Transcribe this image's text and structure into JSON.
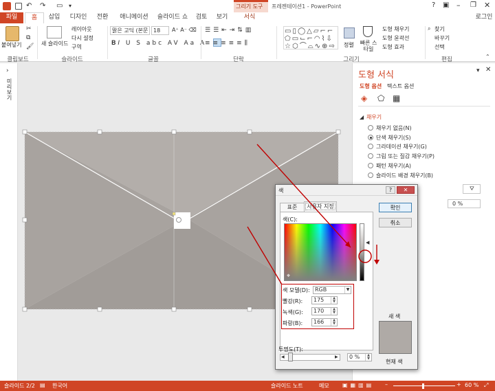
{
  "title": {
    "app_title": "프레젠테이션1 - PowerPoint",
    "context_group": "그리기 도구"
  },
  "tabs": [
    "파일",
    "홈",
    "삽입",
    "디자인",
    "전환",
    "애니메이션",
    "슬라이드 쇼",
    "검토",
    "보기",
    "서식"
  ],
  "account": "로그인",
  "ribbon": {
    "paste": "붙여넣기",
    "new_slide": "새 슬라이드",
    "layout": "레이아웃",
    "reset": "다시 설정",
    "section": "구역",
    "font_name": "맑은 고딕 (본문",
    "font_size": "18",
    "arrange": "정렬",
    "quick_styles": "빠른 스타일",
    "shape_fill": "도형 채우기",
    "shape_outline": "도형 윤곽선",
    "shape_effects": "도형 효과",
    "find": "찾기",
    "replace": "바꾸기",
    "select": "선택",
    "groups": {
      "clipboard": "클립보드",
      "slides": "슬라이드",
      "font": "글꼴",
      "paragraph": "단락",
      "drawing": "그리기",
      "editing": "편집"
    }
  },
  "left_pane": {
    "thumbnails_label": "미리보기"
  },
  "format_pane": {
    "title": "도형 서식",
    "tab_shape": "도형 옵션",
    "tab_text": "텍스트 옵션",
    "section_fill": "채우기",
    "fill_options": [
      "채우기 없음(N)",
      "단색 채우기(S)",
      "그라데이션 채우기(G)",
      "그림 또는 질감 채우기(P)",
      "패턴 채우기(A)",
      "슬라이드 배경 채우기(B)"
    ],
    "selected_fill": 1,
    "transparency_value": "0 %"
  },
  "dialog": {
    "title": "색",
    "tab_standard": "표준",
    "tab_custom": "사용자 지정",
    "colors_label": "색(C):",
    "color_model_label": "색 모델(D):",
    "color_model_value": "RGB",
    "red_label": "빨강(R):",
    "red_value": "175",
    "green_label": "녹색(G):",
    "green_value": "170",
    "blue_label": "파랑(B):",
    "blue_value": "166",
    "transparency_label": "투명도(T):",
    "transparency_value": "0 %",
    "ok": "확인",
    "cancel": "취소",
    "new_label": "새 색",
    "current_label": "현재 색"
  },
  "status": {
    "slide": "슬라이드 2/2",
    "language": "한국어",
    "notes": "슬라이드 노트",
    "comments": "메모",
    "zoom": "60 %"
  },
  "colors": {
    "accent": "#d04525",
    "shape_fill": "#afaaa6",
    "shape_dark": "#a39e9a",
    "highlight": "#c00000"
  }
}
